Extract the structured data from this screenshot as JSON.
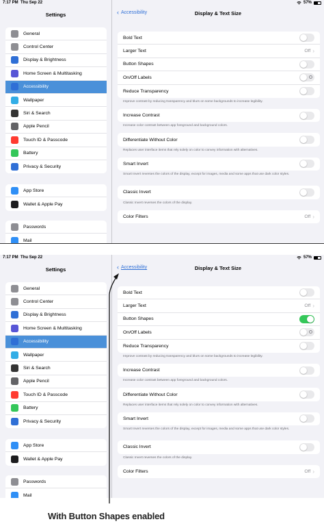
{
  "status": {
    "time": "7:17 PM",
    "date": "Thu Sep 22",
    "battery": "57%"
  },
  "sidebar": {
    "title": "Settings",
    "groups": [
      [
        {
          "label": "General",
          "icon": "gear-icon",
          "color": "#8e8e93"
        },
        {
          "label": "Control Center",
          "icon": "control-center-icon",
          "color": "#8e8e93"
        },
        {
          "label": "Display & Brightness",
          "icon": "display-icon",
          "color": "#2f6fd6"
        },
        {
          "label": "Home Screen & Multitasking",
          "icon": "home-screen-icon",
          "color": "#5856d6"
        },
        {
          "label": "Accessibility",
          "icon": "accessibility-icon",
          "color": "#2f6fd6",
          "selected": true
        },
        {
          "label": "Wallpaper",
          "icon": "wallpaper-icon",
          "color": "#32ade6"
        },
        {
          "label": "Siri & Search",
          "icon": "siri-icon",
          "color": "#333333"
        },
        {
          "label": "Apple Pencil",
          "icon": "pencil-icon",
          "color": "#636366"
        },
        {
          "label": "Touch ID & Passcode",
          "icon": "fingerprint-icon",
          "color": "#ff3b30"
        },
        {
          "label": "Battery",
          "icon": "battery-icon",
          "color": "#34c759"
        },
        {
          "label": "Privacy & Security",
          "icon": "hand-icon",
          "color": "#2f6fd6"
        }
      ],
      [
        {
          "label": "App Store",
          "icon": "app-store-icon",
          "color": "#2f8ff6"
        },
        {
          "label": "Wallet & Apple Pay",
          "icon": "wallet-icon",
          "color": "#1c1c1e"
        }
      ],
      [
        {
          "label": "Passwords",
          "icon": "key-icon",
          "color": "#8e8e93"
        },
        {
          "label": "Mail",
          "icon": "mail-icon",
          "color": "#2f8ff6"
        }
      ]
    ]
  },
  "detail": {
    "back_label": "Accessibility",
    "title": "Display & Text Size",
    "rows": {
      "bold_text": "Bold Text",
      "larger_text": "Larger Text",
      "larger_text_value": "Off",
      "button_shapes": "Button Shapes",
      "on_off_labels": "On/Off Labels",
      "reduce_transparency": "Reduce Transparency",
      "reduce_transparency_footer": "Improve contrast by reducing transparency and blurs on some backgrounds to increase legibility.",
      "increase_contrast": "Increase Contrast",
      "increase_contrast_footer": "Increase color contrast between app foreground and background colors.",
      "differentiate": "Differentiate Without Color",
      "differentiate_footer": "Replaces user interface items that rely solely on color to convey information with alternatives.",
      "smart_invert": "Smart Invert",
      "smart_invert_footer": "Smart Invert reverses the colors of the display, except for images, media and some apps that use dark color styles.",
      "classic_invert": "Classic Invert",
      "classic_invert_footer": "Classic Invert reverses the colors of the display.",
      "color_filters": "Color Filters",
      "color_filters_value": "Off"
    }
  },
  "screens": [
    {
      "button_shapes_on": false
    },
    {
      "button_shapes_on": true
    }
  ],
  "caption": "With Button Shapes enabled",
  "colors": {
    "accent": "#2f6fd6",
    "toggle_on": "#34c759",
    "selected": "#4a90d9"
  }
}
